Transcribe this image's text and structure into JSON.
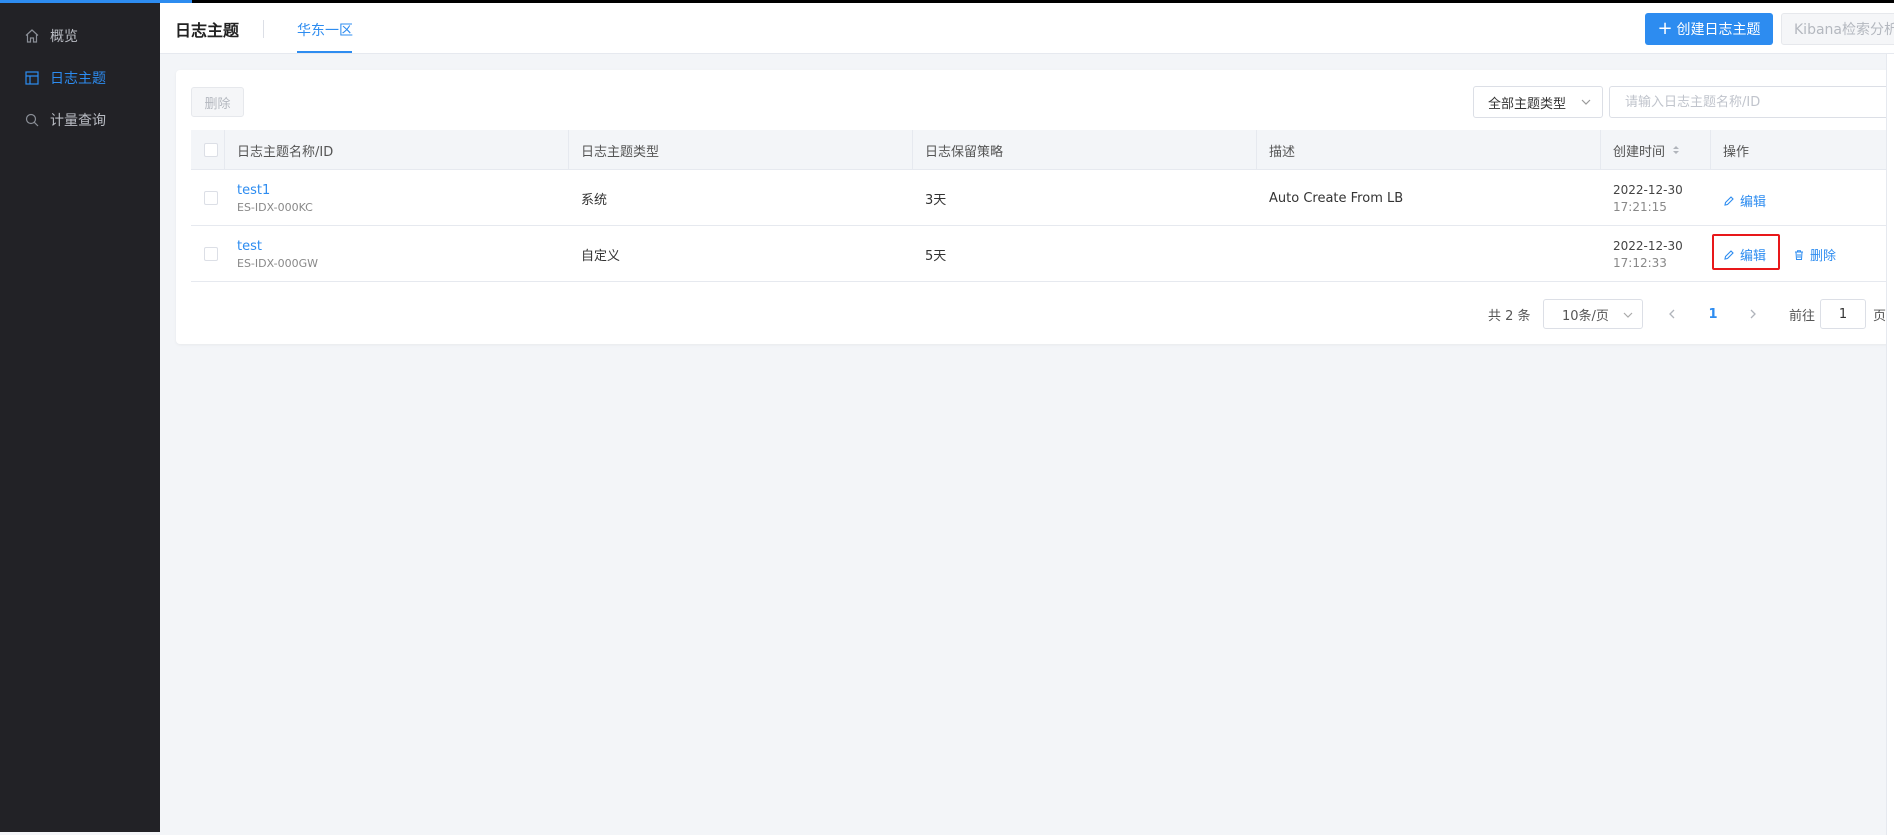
{
  "sidebar": {
    "items": [
      {
        "label": "概览",
        "icon": "home-icon",
        "active": false
      },
      {
        "label": "日志主题",
        "icon": "table-icon",
        "active": true
      },
      {
        "label": "计量查询",
        "icon": "search-icon",
        "active": false
      }
    ]
  },
  "header": {
    "title": "日志主题",
    "region_tab": "华东一区",
    "create_button": "创建日志主题",
    "kibana_button": "Kibana检索分析"
  },
  "toolbar": {
    "delete_label": "删除",
    "type_filter": "全部主题类型",
    "search_placeholder": "请输入日志主题名称/ID"
  },
  "table": {
    "columns": [
      "日志主题名称/ID",
      "日志主题类型",
      "日志保留策略",
      "描述",
      "创建时间",
      "操作"
    ],
    "rows": [
      {
        "name": "test1",
        "id": "ES-IDX-000KC",
        "type": "系统",
        "retention": "3天",
        "description": "Auto Create From LB",
        "created_date": "2022-12-30",
        "created_time": "17:21:15",
        "actions": [
          "编辑"
        ]
      },
      {
        "name": "test",
        "id": "ES-IDX-000GW",
        "type": "自定义",
        "retention": "5天",
        "description": "",
        "created_date": "2022-12-30",
        "created_time": "17:12:33",
        "actions": [
          "编辑",
          "删除"
        ]
      }
    ]
  },
  "pagination": {
    "total_text": "共 2 条",
    "page_size": "10条/页",
    "current_page": "1",
    "goto_label": "前往",
    "goto_value": "1",
    "page_suffix": "页"
  },
  "colors": {
    "accent": "#2d8cf0",
    "sidebar_bg": "#222226",
    "highlight": "#e8181a"
  }
}
